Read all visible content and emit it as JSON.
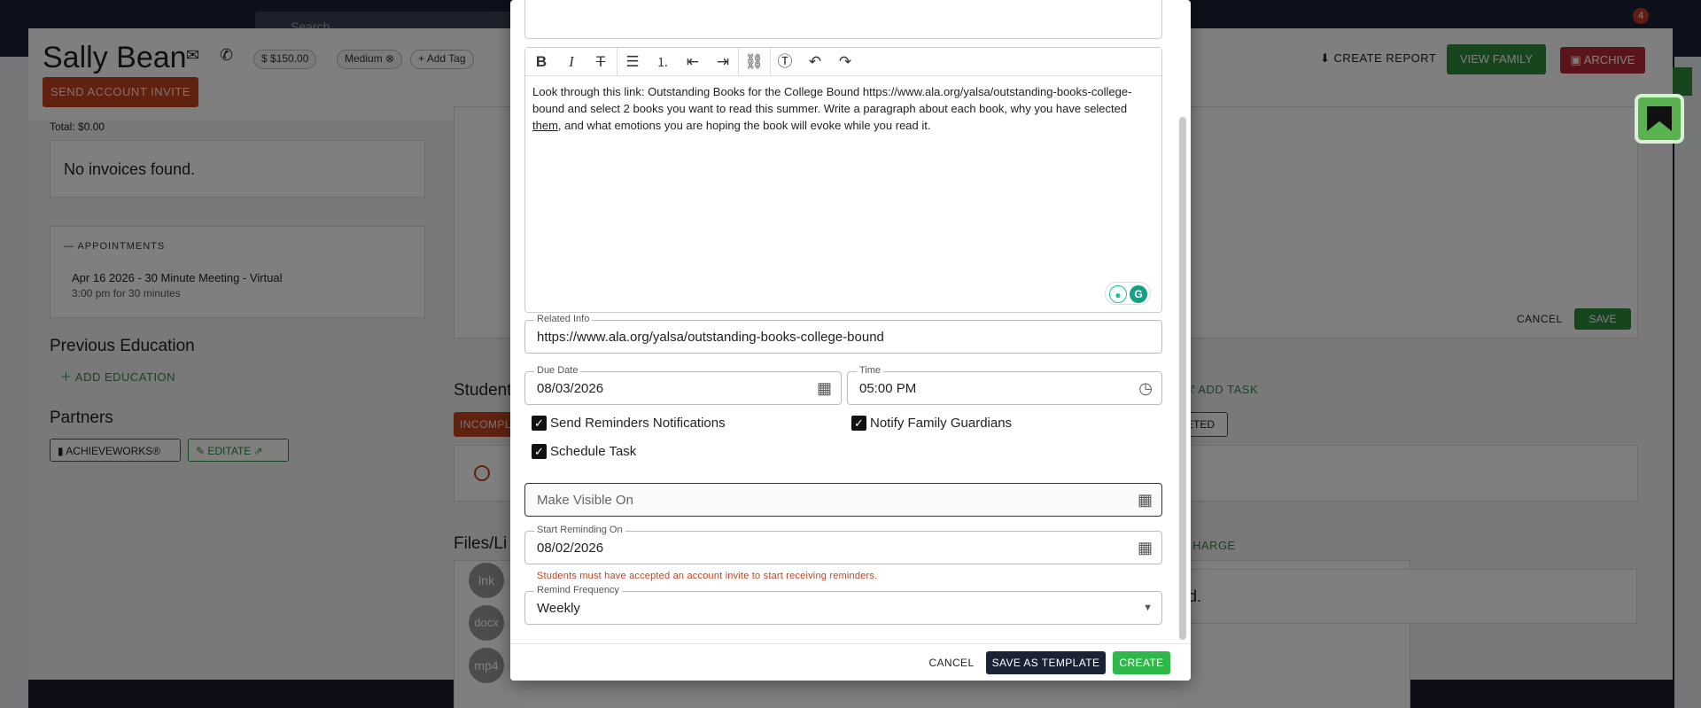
{
  "appbar": {
    "search_placeholder": "Search...",
    "notifications_count": "4"
  },
  "profile": {
    "name": "Sally Bean",
    "balance": "$150.00",
    "priority_chip": "Medium",
    "add_tag_label": "Add Tag",
    "send_invite_label": "SEND ACCOUNT INVITE",
    "create_report_label": "CREATE REPORT",
    "view_family_label": "VIEW FAMILY",
    "archive_label": "ARCHIVE"
  },
  "left": {
    "total_label": "Total: $0.00",
    "no_invoices": "No invoices found.",
    "appointments_title": "APPOINTMENTS",
    "appointment_title": "Apr 16 2026 - 30 Minute Meeting - Virtual",
    "appointment_time": "3:00 pm for 30 minutes",
    "prev_education_title": "Previous Education",
    "add_education_label": "ADD EDUCATION",
    "partners_title": "Partners",
    "partner_1": "ACHIEVEWORKS®",
    "partner_2": "EDITATE"
  },
  "right": {
    "cancel_label": "CANCEL",
    "save_label": "SAVE",
    "student_tasks_title": "Student",
    "add_task_label": "ADD TASK",
    "incomplete_tab": "INCOMPL",
    "completed_tab": "ETED",
    "files_title": "Files/Li",
    "charge_label": "HARGE",
    "found_text": "nd.",
    "file_types": [
      "lnk",
      "docx",
      "mp4"
    ]
  },
  "modal": {
    "description_text_1": "Look through this link: Outstanding Books for the College Bound https://www.ala.org/yalsa/outstanding-books-college-bound and select 2 books you want to read this summer. Write a paragraph about each book, why you have selected ",
    "description_underlined": "them",
    "description_text_2": ", and what emotions you are hoping the book will evoke while you read it.",
    "related_info_label": "Related Info",
    "related_info_value": "https://www.ala.org/yalsa/outstanding-books-college-bound",
    "due_date_label": "Due Date",
    "due_date_value": "08/03/2026",
    "time_label": "Time",
    "time_value": "05:00 PM",
    "send_reminders_label": "Send Reminders Notifications",
    "notify_guardians_label": "Notify Family Guardians",
    "schedule_task_label": "Schedule Task",
    "make_visible_placeholder": "Make Visible On",
    "start_reminding_label": "Start Reminding On",
    "start_reminding_value": "08/02/2026",
    "helper_text": "Students must have accepted an account invite to start receiving reminders.",
    "remind_frequency_label": "Remind Frequency",
    "remind_frequency_value": "Weekly",
    "cancel_label": "CANCEL",
    "save_template_label": "SAVE AS TEMPLATE",
    "create_label": "CREATE"
  },
  "colors": {
    "primary_green": "#2e8b3a",
    "orange": "#c1441d",
    "navy": "#1a2236",
    "red": "#b52a35"
  }
}
